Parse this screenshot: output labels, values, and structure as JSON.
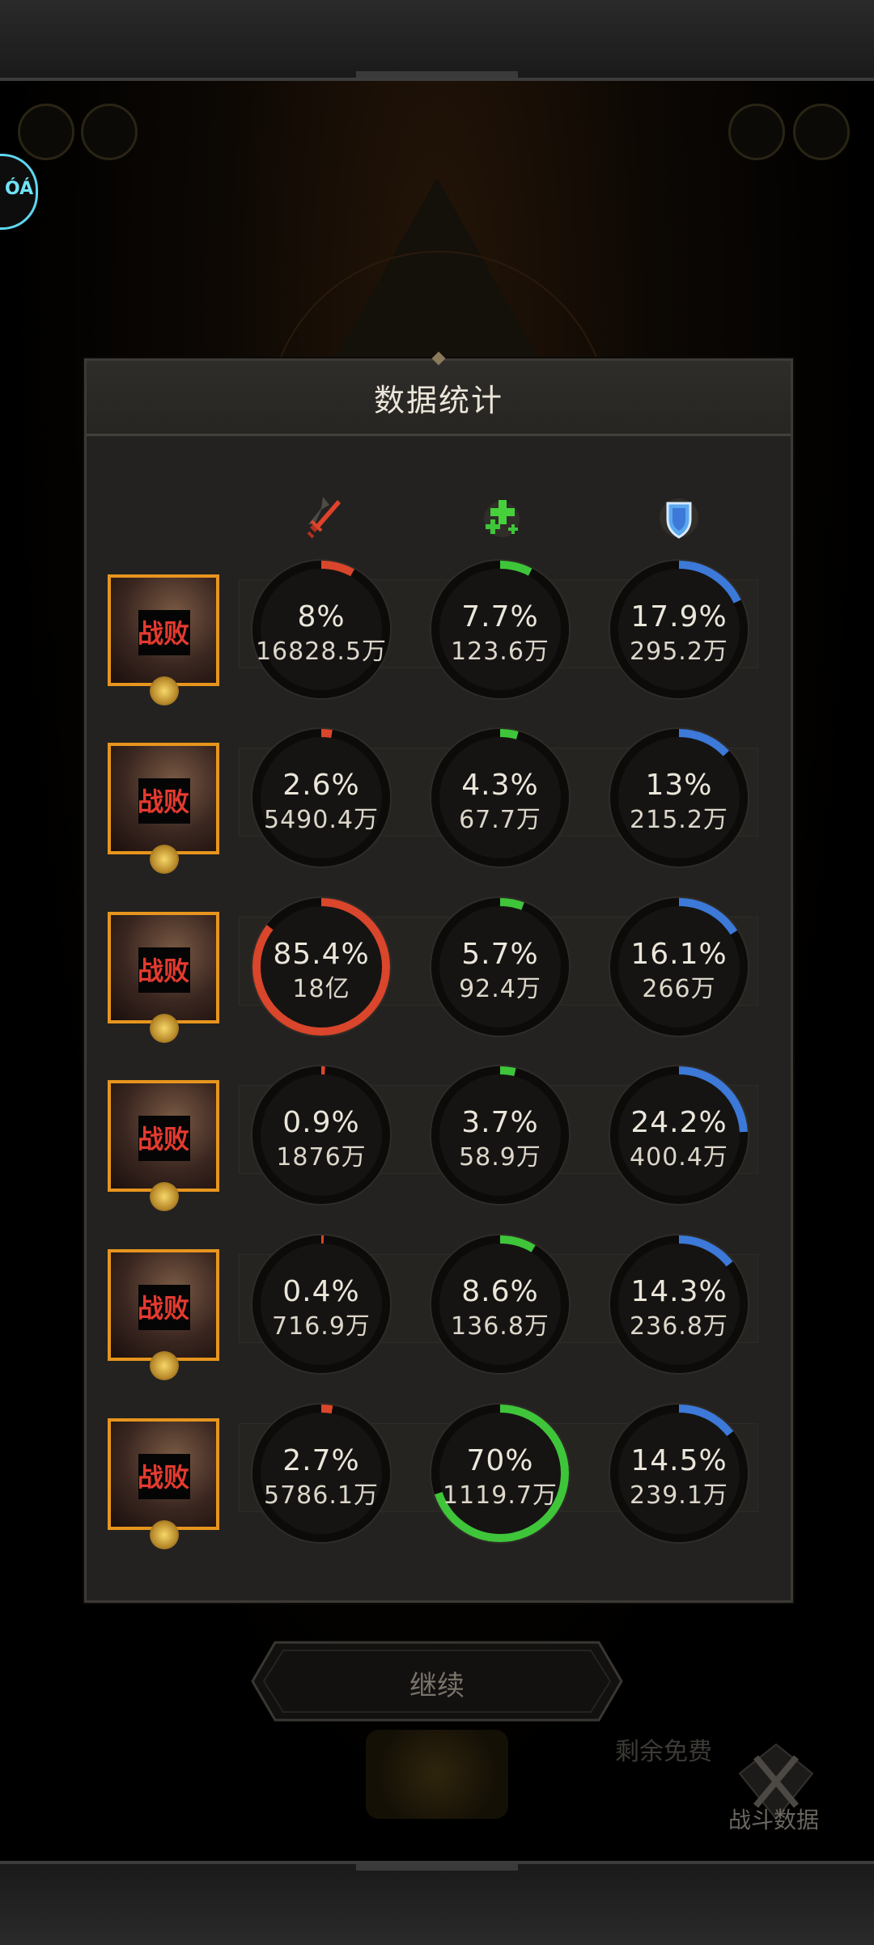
{
  "panel": {
    "title": "数据统计",
    "columns": [
      {
        "name": "damage",
        "icon": "red-sword-icon",
        "color": "#d9462b"
      },
      {
        "name": "healing",
        "icon": "green-plus-icon",
        "color": "#3fc53a"
      },
      {
        "name": "damage-taken",
        "icon": "blue-shield-icon",
        "color": "#3c79d8"
      }
    ],
    "rows": [
      {
        "status": "战败",
        "stats": [
          {
            "pct": "8%",
            "value": 0.08,
            "amount": "16828.5万"
          },
          {
            "pct": "7.7%",
            "value": 0.077,
            "amount": "123.6万"
          },
          {
            "pct": "17.9%",
            "value": 0.179,
            "amount": "295.2万"
          }
        ]
      },
      {
        "status": "战败",
        "stats": [
          {
            "pct": "2.6%",
            "value": 0.026,
            "amount": "5490.4万"
          },
          {
            "pct": "4.3%",
            "value": 0.043,
            "amount": "67.7万"
          },
          {
            "pct": "13%",
            "value": 0.13,
            "amount": "215.2万"
          }
        ]
      },
      {
        "status": "战败",
        "stats": [
          {
            "pct": "85.4%",
            "value": 0.854,
            "amount": "18亿"
          },
          {
            "pct": "5.7%",
            "value": 0.057,
            "amount": "92.4万"
          },
          {
            "pct": "16.1%",
            "value": 0.161,
            "amount": "266万"
          }
        ]
      },
      {
        "status": "战败",
        "stats": [
          {
            "pct": "0.9%",
            "value": 0.009,
            "amount": "1876万"
          },
          {
            "pct": "3.7%",
            "value": 0.037,
            "amount": "58.9万"
          },
          {
            "pct": "24.2%",
            "value": 0.242,
            "amount": "400.4万"
          }
        ]
      },
      {
        "status": "战败",
        "stats": [
          {
            "pct": "0.4%",
            "value": 0.004,
            "amount": "716.9万"
          },
          {
            "pct": "8.6%",
            "value": 0.086,
            "amount": "136.8万"
          },
          {
            "pct": "14.3%",
            "value": 0.143,
            "amount": "236.8万"
          }
        ]
      },
      {
        "status": "战败",
        "stats": [
          {
            "pct": "2.7%",
            "value": 0.027,
            "amount": "5786.1万"
          },
          {
            "pct": "70%",
            "value": 0.7,
            "amount": "1119.7万"
          },
          {
            "pct": "14.5%",
            "value": 0.145,
            "amount": "239.1万"
          }
        ]
      }
    ]
  },
  "continue_button": {
    "label": "继续"
  },
  "battle_data": {
    "label": "战斗数据",
    "icon": "crossed-swords-icon"
  },
  "bottom_partial_text": "剩余免费",
  "side_tag": {
    "text": "ÓÁ"
  }
}
